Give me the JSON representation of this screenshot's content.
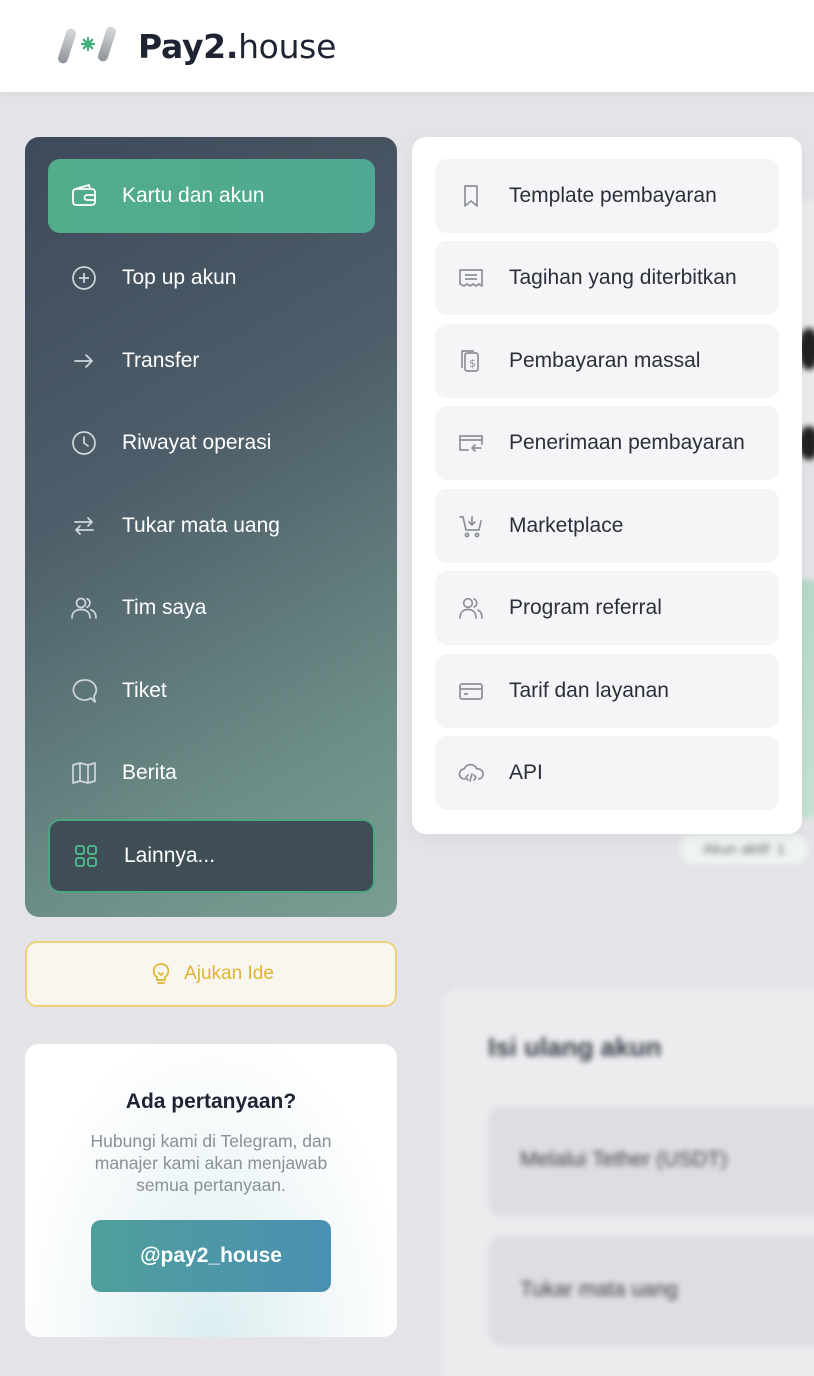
{
  "header": {
    "logo_bold": "Pay2.",
    "logo_light": "house"
  },
  "sidebar": {
    "items": [
      {
        "label": "Kartu dan akun",
        "icon": "wallet-icon",
        "active": true
      },
      {
        "label": "Top up akun",
        "icon": "plus-circle-icon"
      },
      {
        "label": "Transfer",
        "icon": "arrow-right-icon"
      },
      {
        "label": "Riwayat operasi",
        "icon": "clock-icon"
      },
      {
        "label": "Tukar mata uang",
        "icon": "exchange-icon"
      },
      {
        "label": "Tim saya",
        "icon": "users-icon"
      },
      {
        "label": "Tiket",
        "icon": "chat-bubble-icon"
      },
      {
        "label": "Berita",
        "icon": "book-icon"
      },
      {
        "label": "Lainnya...",
        "icon": "grid-icon",
        "selected": true
      }
    ]
  },
  "idea_button": {
    "label": "Ajukan Ide",
    "icon": "lightbulb-icon"
  },
  "help": {
    "title": "Ada pertanyaan?",
    "text": "Hubungi kami di Telegram, dan manajer kami akan menjawab semua pertanyaan.",
    "button": "@pay2_house"
  },
  "more_menu": {
    "items": [
      {
        "label": "Template pembayaran",
        "icon": "bookmark-icon"
      },
      {
        "label": "Tagihan yang diterbitkan",
        "icon": "receipt-icon"
      },
      {
        "label": "Pembayaran massal",
        "icon": "mass-payment-icon"
      },
      {
        "label": "Penerimaan pembayaran",
        "icon": "payment-receive-icon"
      },
      {
        "label": "Marketplace",
        "icon": "cart-icon"
      },
      {
        "label": "Program referral",
        "icon": "users-icon"
      },
      {
        "label": "Tarif dan layanan",
        "icon": "card-icon"
      },
      {
        "label": "API",
        "icon": "cloud-code-icon"
      }
    ]
  },
  "background": {
    "badge": "Akun aktif: 1",
    "panel_title": "Isi ulang akun",
    "rows": [
      "Melalui Tether (USDT)",
      "Tukar mata uang"
    ]
  },
  "colors": {
    "accent_green": "#52ad8b",
    "sidebar_dark": "#3e4a5a",
    "idea_yellow": "#e0b52e",
    "help_button": "#4a90b2"
  }
}
